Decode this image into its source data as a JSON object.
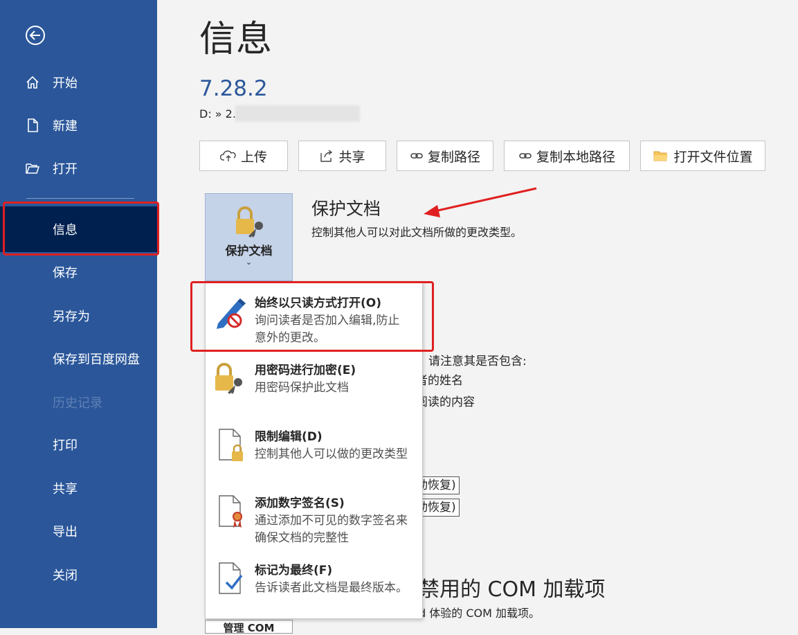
{
  "sidebar": {
    "items": [
      {
        "label": "开始",
        "icon": "home-icon"
      },
      {
        "label": "新建",
        "icon": "new-document-icon"
      },
      {
        "label": "打开",
        "icon": "open-folder-icon"
      },
      {
        "label": "信息"
      },
      {
        "label": "保存"
      },
      {
        "label": "另存为"
      },
      {
        "label": "保存到百度网盘"
      },
      {
        "label": "历史记录"
      },
      {
        "label": "打印"
      },
      {
        "label": "共享"
      },
      {
        "label": "导出"
      },
      {
        "label": "关闭"
      }
    ]
  },
  "main": {
    "title": "信息",
    "doc_name": "7.28.2",
    "doc_path": "D: » 2.s",
    "toolbar": [
      {
        "label": "上传",
        "icon": "cloud-upload-icon"
      },
      {
        "label": "共享",
        "icon": "share-icon"
      },
      {
        "label": "复制路径",
        "icon": "link-icon"
      },
      {
        "label": "复制本地路径",
        "icon": "link-icon"
      },
      {
        "label": "打开文件位置",
        "icon": "folder-icon"
      }
    ],
    "protect": {
      "tile_label": "保护文档",
      "tile_caret": "⌄",
      "heading": "保护文档",
      "desc": "控制其他人可以对此文档所做的更改类型。"
    },
    "background_fragments": {
      "inspect_line": "请注意其是否包含:",
      "author_line": "者的姓名",
      "read_line": "阅读的内容",
      "autorecover_1": "动恢复)",
      "autorecover_2": "动恢复)",
      "com_heading": "禁用的 COM 加载项",
      "com_sub": "d 体验的 COM 加载项。",
      "com_button": "管理 COM"
    }
  },
  "menu": {
    "items": [
      {
        "title": "始终以只读方式打开(O)",
        "desc": "询问读者是否加入编辑,防止意外的更改。",
        "icon": "read-only-pencil-icon"
      },
      {
        "title": "用密码进行加密(E)",
        "desc": "用密码保护此文档",
        "icon": "lock-key-icon"
      },
      {
        "title": "限制编辑(D)",
        "desc": "控制其他人可以做的更改类型",
        "icon": "restrict-editing-icon"
      },
      {
        "title": "添加数字签名(S)",
        "desc": "通过添加不可见的数字签名来确保文档的完整性",
        "icon": "digital-signature-icon"
      },
      {
        "title": "标记为最终(F)",
        "desc": "告诉读者此文档是最终版本。",
        "icon": "mark-final-icon"
      }
    ]
  },
  "colors": {
    "sidebar_bg": "#2b579a",
    "sidebar_active": "#002050",
    "highlight_red": "#e02020",
    "accent_blue": "#2b579a"
  }
}
